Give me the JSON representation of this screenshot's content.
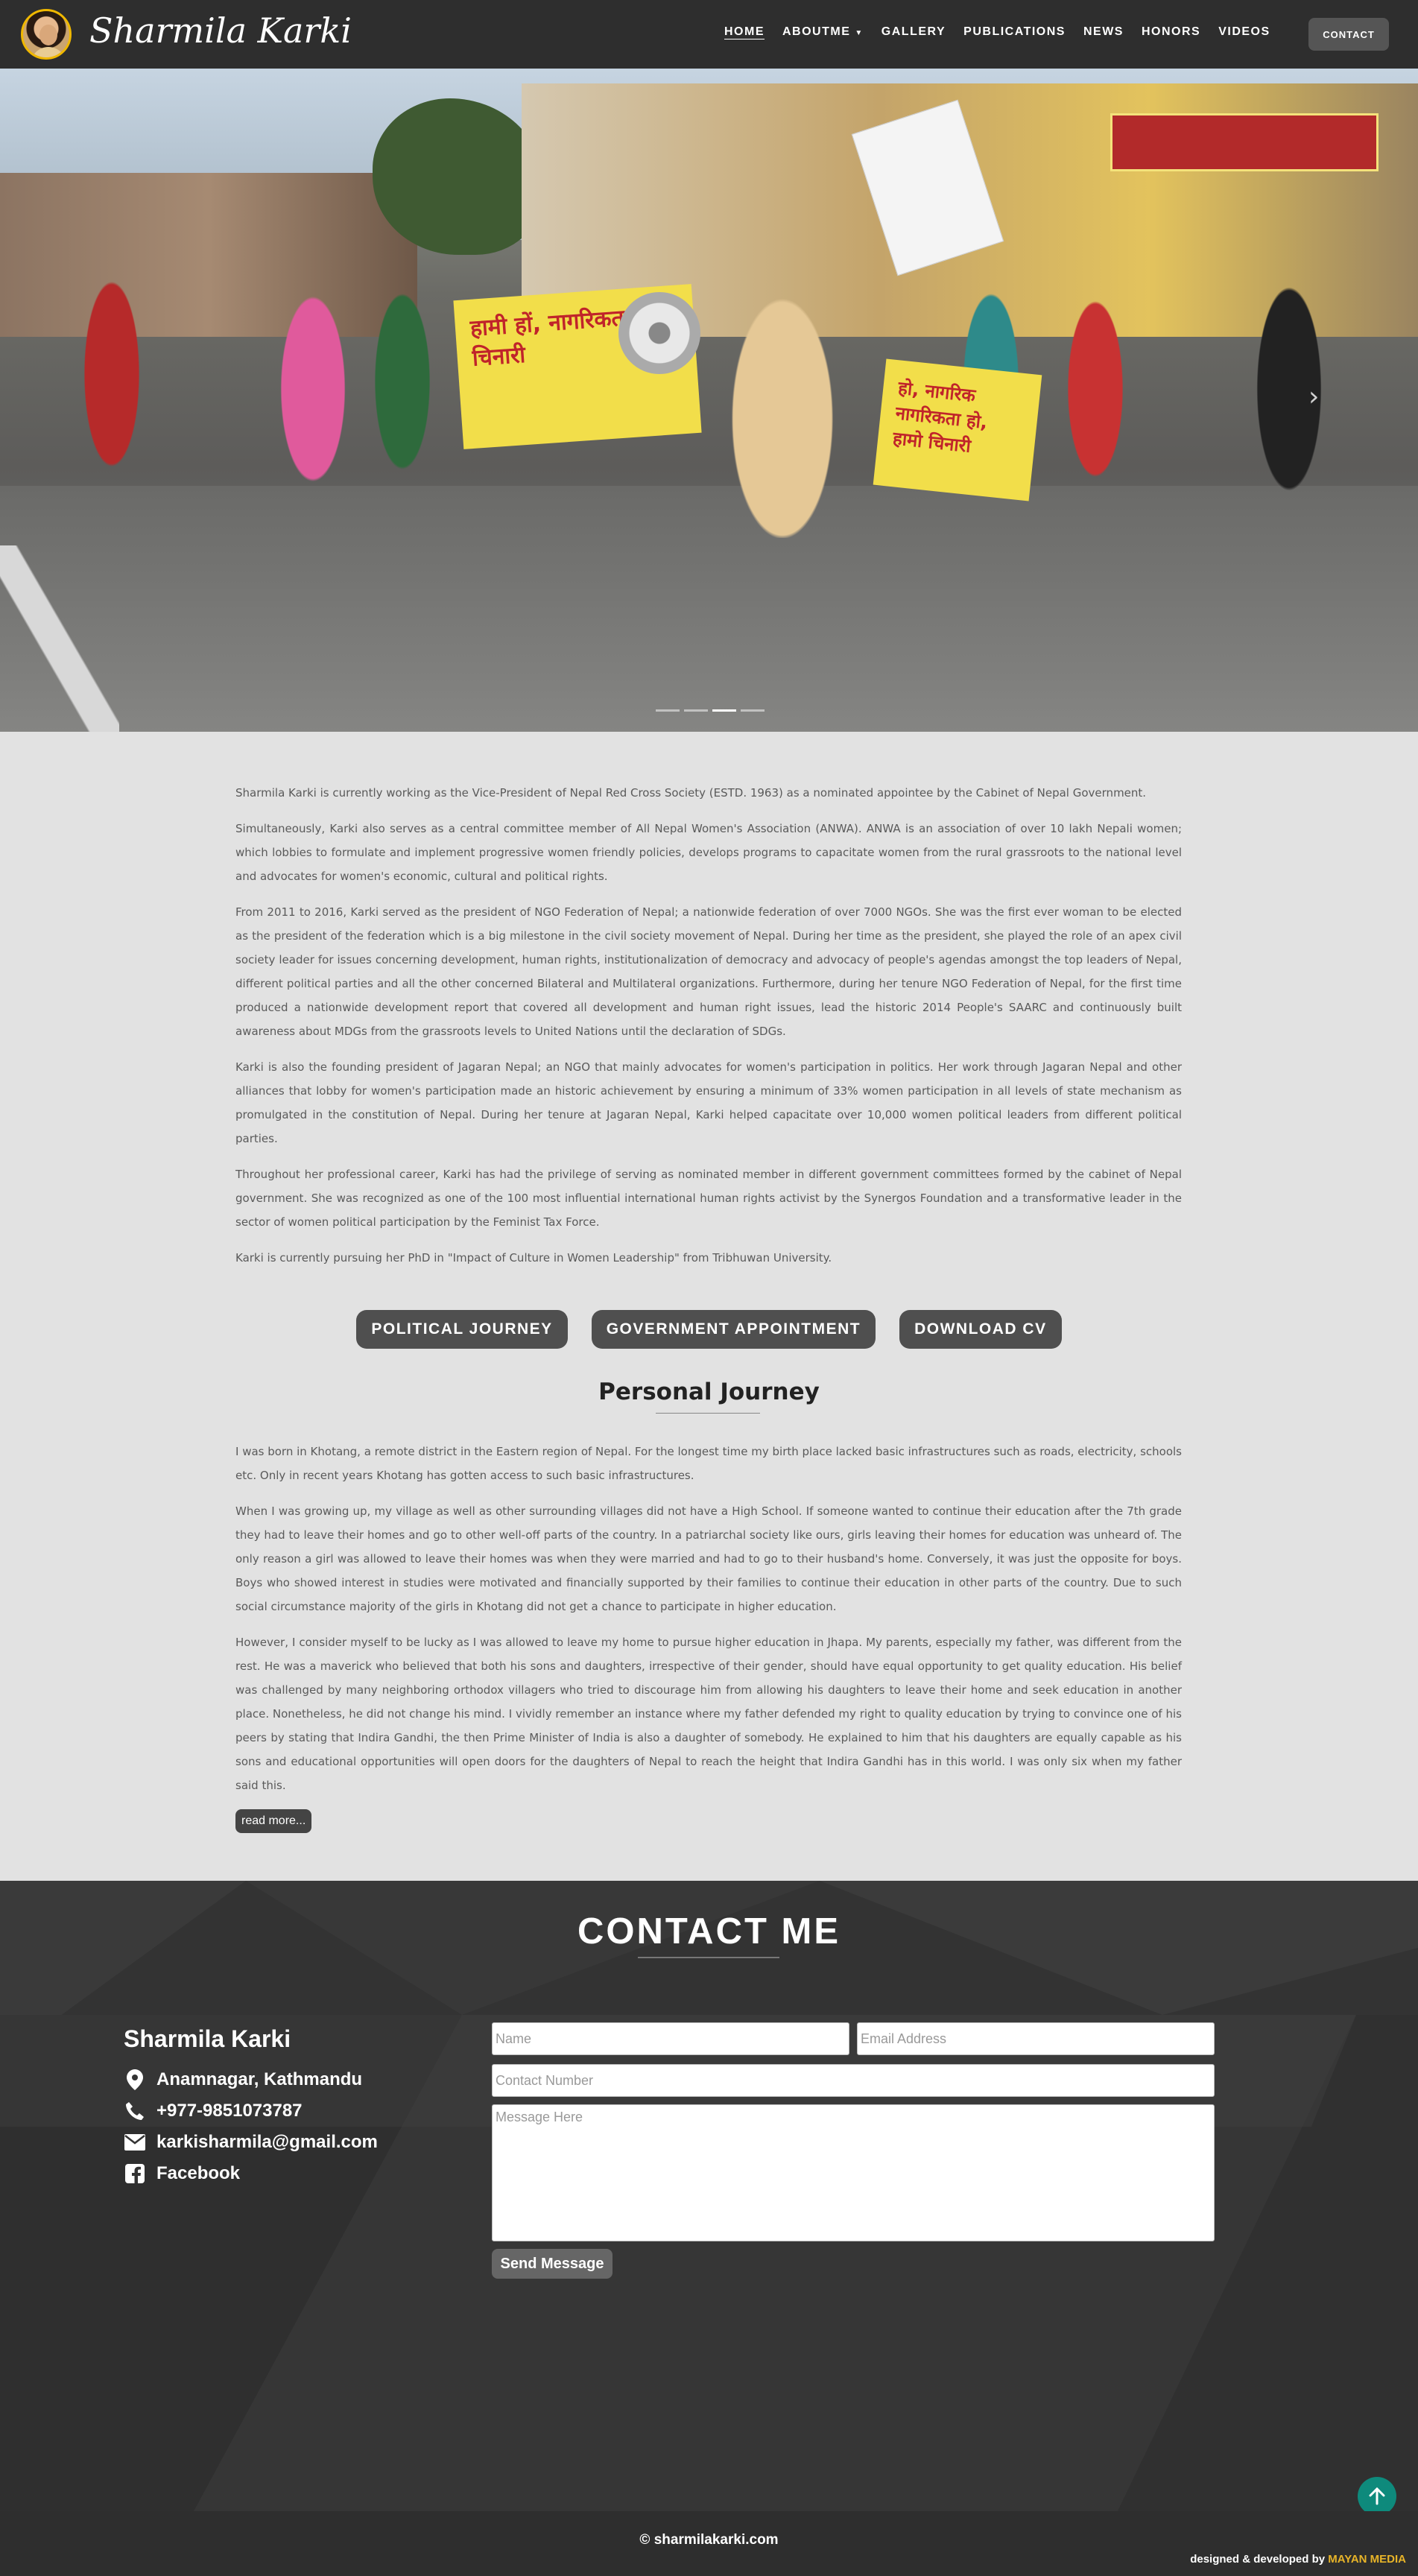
{
  "header": {
    "brand": "Sharmila Karki",
    "nav": [
      {
        "label": "HOME"
      },
      {
        "label": "ABOUTME"
      },
      {
        "label": "GALLERY"
      },
      {
        "label": "PUBLICATIONS"
      },
      {
        "label": "NEWS"
      },
      {
        "label": "HONORS"
      },
      {
        "label": "VIDEOS"
      }
    ],
    "contact_label": "CONTACT"
  },
  "hero": {
    "banner_left": "हामी हों, नागरिकता हामो चिनारी",
    "banner_right": "हो, नागरिक नागरिकता हो, हामो चिनारी",
    "next_glyph": "›",
    "slide_count": 4,
    "active_slide": 3
  },
  "about": {
    "paragraphs": [
      "Sharmila Karki is currently working as the Vice-President of Nepal Red Cross Society (ESTD. 1963) as a nominated appointee by the Cabinet of Nepal Government.",
      "Simultaneously, Karki also serves as a central committee member of All Nepal Women's Association (ANWA). ANWA is an association of over 10 lakh Nepali women; which lobbies to formulate and implement progressive women friendly policies, develops programs to capacitate women from the rural grassroots to the national level and advocates for women's economic, cultural and political rights.",
      "From 2011 to 2016, Karki served as the president of NGO Federation of Nepal; a nationwide federation of over 7000 NGOs. She was the first ever woman to be elected as the president of the federation which is a big milestone in the civil society movement of Nepal. During her time as the president, she played the role of an apex civil society leader for issues concerning development, human rights, institutionalization of democracy and advocacy of people's agendas amongst the top leaders of Nepal, different political parties and all the other concerned Bilateral and Multilateral organizations. Furthermore, during her tenure NGO Federation of Nepal, for the first time produced a nationwide development report that covered all development and human right issues, lead the historic 2014 People's SAARC and continuously built awareness about MDGs from the grassroots levels to United Nations until the declaration of SDGs.",
      "Karki is also the founding president of Jagaran Nepal; an NGO that mainly advocates for women's participation in politics. Her work through Jagaran Nepal and other alliances that lobby for women's participation made an historic achievement by ensuring a minimum of 33% women participation in all levels of state mechanism as promulgated in the constitution of Nepal. During her tenure at Jagaran Nepal, Karki helped capacitate over 10,000 women political leaders from different political parties.",
      "Throughout her professional career, Karki has had the privilege of serving as nominated member in different government committees formed by the cabinet of Nepal government. She was recognized as one of the 100 most influential international human rights activist by the Synergos Foundation and a transformative leader in the sector of women political participation by the Feminist Tax Force.",
      "Karki is currently pursuing her PhD in \"Impact of Culture in Women Leadership\" from Tribhuwan University."
    ]
  },
  "actions": {
    "political": "POLITICAL JOURNEY",
    "government": "GOVERNMENT APPOINTMENT",
    "cv": "DOWNLOAD CV"
  },
  "journey": {
    "title": "Personal Journey",
    "paragraphs": [
      "I was born in Khotang, a remote district in the Eastern region of Nepal. For the longest time my birth place lacked basic infrastructures such as roads, electricity, schools etc. Only in recent years Khotang has gotten access to such basic infrastructures.",
      "When I was growing up, my village as well as other surrounding villages did not have a High School. If someone wanted to continue their education after the 7th grade they had to leave their homes and go to other well-off parts of the country. In a patriarchal society like ours, girls leaving their homes for education was unheard of. The only reason a girl was allowed to leave their homes was when they were married and had to go to their husband's home. Conversely, it was just the opposite for boys. Boys who showed interest in studies were motivated and financially supported by their families to continue their education in other parts of the country. Due to such social circumstance majority of the girls in Khotang did not get a chance to participate in higher education.",
      "However, I consider myself to be lucky as I was allowed to leave my home to pursue higher education in Jhapa. My parents, especially my father, was different from the rest. He was a maverick who believed that both his sons and daughters, irrespective of their gender, should have equal opportunity to get quality education. His belief was challenged by many neighboring orthodox villagers who tried to discourage him from allowing his daughters to leave their home and seek education in another place. Nonetheless, he did not change his mind. I vividly remember an instance where my father defended my right to quality education by trying to convince one of his peers by stating that Indira Gandhi, the then Prime Minister of India is also a daughter of somebody. He explained to him that his daughters are equally capable as his sons and educational opportunities will open doors for the daughters of Nepal to reach the height that Indira Gandhi has in this world. I was only six when my father said this."
    ],
    "read_more": "read more..."
  },
  "contact": {
    "title": "CONTACT ME",
    "name": "Sharmila Karki",
    "address": "Anamnagar, Kathmandu",
    "phone": "+977-9851073787",
    "email": "karkisharmila@gmail.com",
    "social": "Facebook",
    "form": {
      "name_placeholder": "Name",
      "email_placeholder": "Email Address",
      "phone_placeholder": "Contact Number",
      "message_placeholder": "Message Here",
      "send_label": "Send Message"
    }
  },
  "footer": {
    "copyright": "© sharmilakarki.com",
    "credit_prefix": "designed & developed by",
    "credit_brand": "MAYAN MEDIA"
  },
  "colors": {
    "nav_bg": "#2e2e2e",
    "body_bg": "#e2e2e2",
    "button_bg": "#4f4f4f",
    "scroll_top": "#0e8a7c",
    "credit_accent": "#e8b428"
  }
}
